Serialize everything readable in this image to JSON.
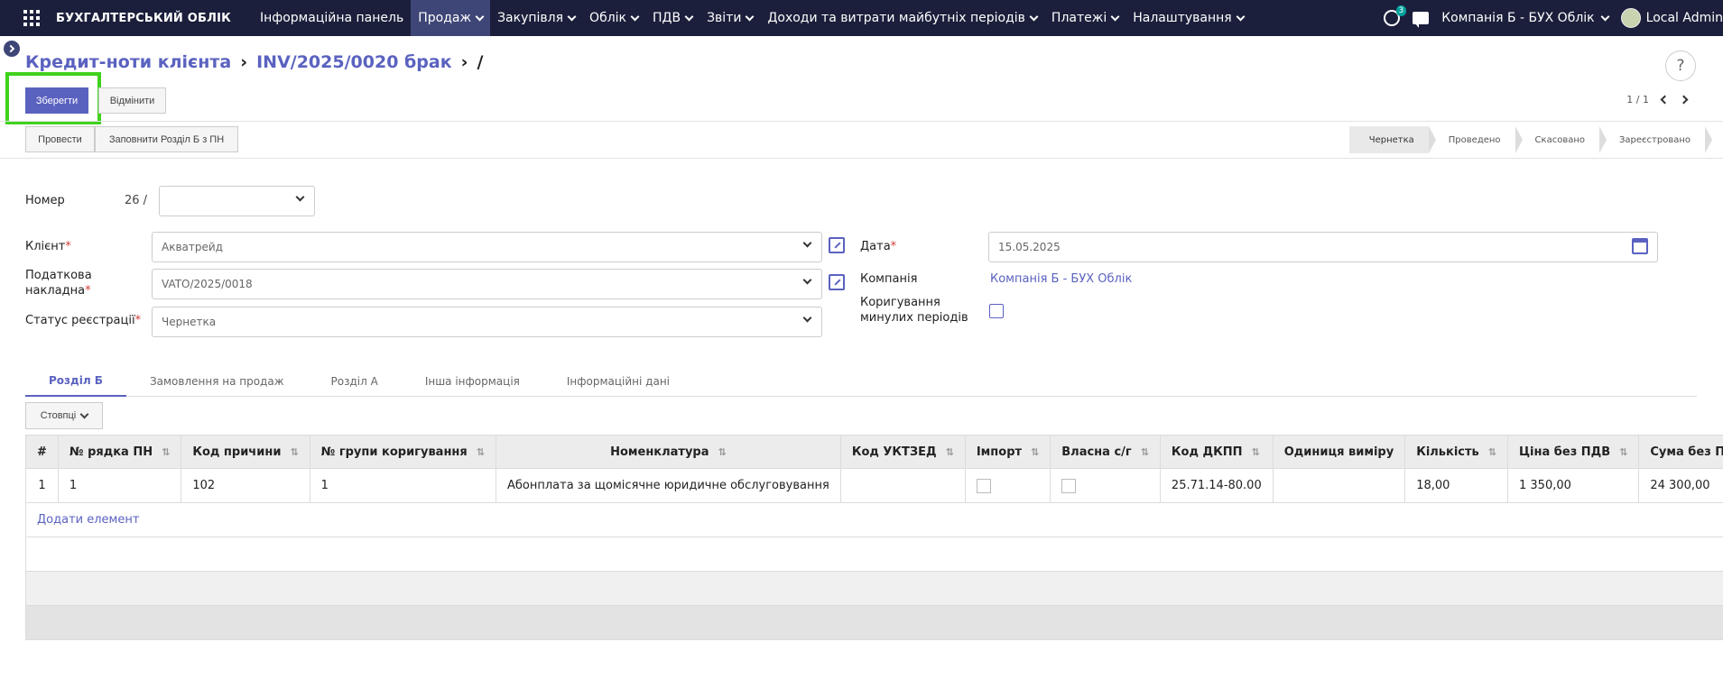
{
  "topbar": {
    "brand": "БУХГАЛТЕРСЬКИЙ ОБЛІК",
    "menu": [
      {
        "label": "Інформаційна панель",
        "dropdown": false
      },
      {
        "label": "Продаж",
        "dropdown": true,
        "active": true
      },
      {
        "label": "Закупівля",
        "dropdown": true
      },
      {
        "label": "Облік",
        "dropdown": true
      },
      {
        "label": "ПДВ",
        "dropdown": true
      },
      {
        "label": "Звіти",
        "dropdown": true
      },
      {
        "label": "Доходи та витрати майбутніх періодів",
        "dropdown": true
      },
      {
        "label": "Платежі",
        "dropdown": true
      },
      {
        "label": "Налаштування",
        "dropdown": true
      }
    ],
    "activity_count": "3",
    "company": "Компанія Б - БУХ Облік",
    "user": "Local Admin"
  },
  "breadcrumb": {
    "root": "Кредит-ноти клієнта",
    "parent": "INV/2025/0020 брак",
    "current": "/"
  },
  "actions": {
    "save": "Зберегти",
    "cancel": "Відмінити",
    "pager": "1 / 1",
    "post": "Провести",
    "fill_section_b": "Заповнити Розділ Б з ПН"
  },
  "stages": [
    "Чернетка",
    "Проведено",
    "Скасовано",
    "Зареєстровано"
  ],
  "active_stage": "Чернетка",
  "form": {
    "number_label": "Номер",
    "number_value": "26  /",
    "client_label": "Клієнт",
    "client_value": "Акватрейд",
    "tax_invoice_label_1": "Податкова",
    "tax_invoice_label_2": "накладна",
    "tax_invoice_value": "VATO/2025/0018",
    "reg_status_label": "Статус реєстрації",
    "reg_status_value": "Чернетка",
    "date_label": "Дата",
    "date_value": "15.05.2025",
    "company_label": "Компанія",
    "company_value": "Компанія Б - БУХ Облік",
    "correction_label_1": "Коригування",
    "correction_label_2": "минулих періодів"
  },
  "tabs": [
    "Розділ Б",
    "Замовлення на продаж",
    "Розділ А",
    "Інша інформація",
    "Інформаційні дані"
  ],
  "columns_button": "Стовпці",
  "table": {
    "headers": [
      "#",
      "№ рядка ПН",
      "Код причини",
      "№ групи коригування",
      "Номенклатура",
      "Код УКТЗЕД",
      "Імпорт",
      "Власна с/г",
      "Код ДКПП",
      "Одиниця виміру",
      "Кількість",
      "Ціна без ПДВ",
      "Сума без ПДВ"
    ],
    "rows": [
      {
        "idx": "1",
        "row_no": "1",
        "reason": "102",
        "group": "1",
        "item": "Абонплата за щомісячне юридичне обслуговування",
        "uktzed": "",
        "dkpp": "25.71.14-80.00",
        "unit": "",
        "qty": "18,00",
        "price": "1 350,00",
        "sum": "24 300,00"
      }
    ],
    "add_line": "Додати елемент"
  },
  "colors": {
    "accent": "#5a62c0",
    "topbar": "#1b1f3b",
    "highlight": "#3fd21c"
  }
}
